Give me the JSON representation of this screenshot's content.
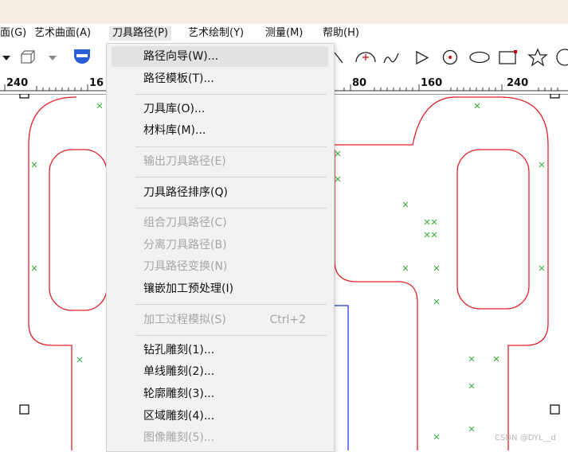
{
  "menubar": {
    "items": [
      {
        "label": "面(G)"
      },
      {
        "label": "艺术曲面(A)"
      },
      {
        "label": "刀具路径(P)"
      },
      {
        "label": "艺术绘制(Y)"
      },
      {
        "label": "测量(M)"
      },
      {
        "label": "帮助(H)"
      }
    ]
  },
  "ruler": {
    "labels": [
      "240",
      "16",
      "80",
      "160",
      "240"
    ]
  },
  "toolpath_menu": {
    "items": [
      {
        "label": "路径向导(W)...",
        "shortcut": "",
        "state": "highlighted"
      },
      {
        "label": "路径模板(T)...",
        "shortcut": "",
        "state": "enabled"
      },
      {
        "label": "刀具库(O)...",
        "shortcut": "",
        "state": "enabled"
      },
      {
        "label": "材料库(M)...",
        "shortcut": "",
        "state": "enabled"
      },
      {
        "label": "输出刀具路径(E)",
        "shortcut": "",
        "state": "disabled"
      },
      {
        "label": "刀具路径排序(Q)",
        "shortcut": "",
        "state": "enabled"
      },
      {
        "label": "组合刀具路径(C)",
        "shortcut": "",
        "state": "disabled"
      },
      {
        "label": "分离刀具路径(B)",
        "shortcut": "",
        "state": "disabled"
      },
      {
        "label": "刀具路径变换(N)",
        "shortcut": "",
        "state": "disabled"
      },
      {
        "label": "镶嵌加工预处理(I)",
        "shortcut": "",
        "state": "enabled"
      },
      {
        "label": "加工过程模拟(S)",
        "shortcut": "Ctrl+2",
        "state": "disabled"
      },
      {
        "label": "钻孔雕刻(1)...",
        "shortcut": "",
        "state": "enabled"
      },
      {
        "label": "单线雕刻(2)...",
        "shortcut": "",
        "state": "enabled"
      },
      {
        "label": "轮廓雕刻(3)...",
        "shortcut": "",
        "state": "enabled"
      },
      {
        "label": "区域雕刻(4)...",
        "shortcut": "",
        "state": "enabled"
      },
      {
        "label": "图像雕刻(5)...",
        "shortcut": "",
        "state": "disabled"
      }
    ]
  },
  "icons": {
    "toolbar": [
      "dropdown-arrow-icon",
      "3d-box-icon",
      "dropdown-arrow-icon",
      "shield-tool-icon",
      "line-tool-icon",
      "arc-tool-icon",
      "curve-tool-icon",
      "triangle-tool-icon",
      "target-circle-icon",
      "ellipse-tool-icon",
      "rectangle-tool-icon",
      "star-tool-icon",
      "circle-tool-icon"
    ]
  },
  "colors": {
    "outline": "#e0202a",
    "selection": "#2030d0",
    "marker": "#33aa33",
    "menu_bg": "#f2f2f2",
    "highlight": "#e2e2e2",
    "disabled_text": "#a6a6a6",
    "titlebar": "#f5ede4"
  },
  "watermark": "CSDN @DYL__d"
}
